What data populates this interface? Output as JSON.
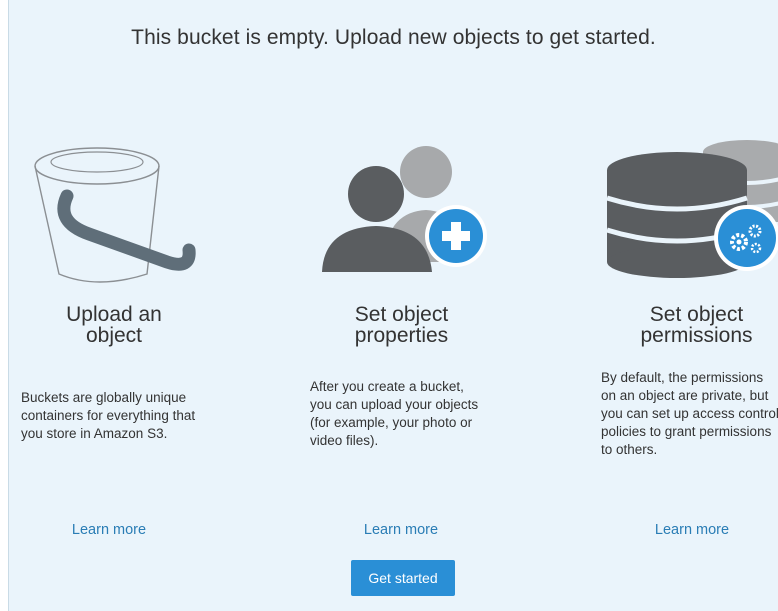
{
  "header": {
    "text": "This bucket is empty. Upload new objects to get started."
  },
  "columns": [
    {
      "icon": "bucket-icon",
      "title_line1": "Upload an",
      "title_line2": "object",
      "description": "Buckets are globally unique containers for everything that you store in Amazon S3.",
      "link": "Learn more"
    },
    {
      "icon": "users-add-icon",
      "title_line1": "Set object",
      "title_line2": "properties",
      "description": "After you create a bucket, you can upload your objects (for example, your photo or video files).",
      "link": "Learn more"
    },
    {
      "icon": "database-gears-icon",
      "title_line1": "Set object",
      "title_line2": "permissions",
      "description": "By default, the permissions on an object are private, but you can set up access control policies to grant permissions to others.",
      "link": "Learn more"
    }
  ],
  "cta": {
    "label": "Get started"
  },
  "colors": {
    "accent": "#2a8fd6",
    "link": "#2a7db5",
    "panel_bg": "#eaf4fb"
  }
}
